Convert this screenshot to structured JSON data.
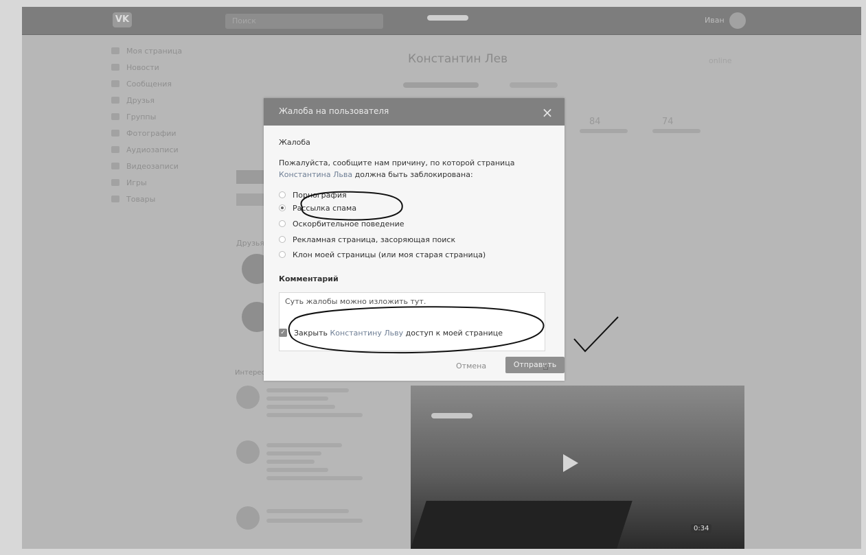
{
  "app": {
    "logo": "VK"
  },
  "header": {
    "search_placeholder": "Поиск",
    "user_name": "Иван"
  },
  "sidebar": {
    "items": [
      {
        "label": "Моя страница",
        "icon": "home-icon"
      },
      {
        "label": "Новости",
        "icon": "news-icon"
      },
      {
        "label": "Сообщения",
        "icon": "message-icon"
      },
      {
        "label": "Друзья",
        "icon": "friends-icon"
      },
      {
        "label": "Группы",
        "icon": "groups-icon"
      },
      {
        "label": "Фотографии",
        "icon": "photo-icon"
      },
      {
        "label": "Аудиозаписи",
        "icon": "music-icon"
      },
      {
        "label": "Видеозаписи",
        "icon": "video-icon"
      },
      {
        "label": "Игры",
        "icon": "games-icon"
      },
      {
        "label": "Товары",
        "icon": "goods-icon"
      }
    ]
  },
  "profile": {
    "name": "Константин Лев",
    "status": "online",
    "stats": [
      {
        "number": "84"
      },
      {
        "number": "74"
      }
    ]
  },
  "left_column": {
    "friends_title": "Друзья",
    "interesting_title": "Интересные страницы"
  },
  "video": {
    "duration": "0:34"
  },
  "modal": {
    "title": "Жалоба на пользователя",
    "close_icon": "close-icon",
    "section_label": "Жалоба",
    "prompt_before": "Пожалуйста, сообщите нам причину, по которой страница",
    "prompt_link": "Константина Льва",
    "prompt_after": "должна быть заблокирована:",
    "options": [
      {
        "label": "Порнография",
        "checked": false
      },
      {
        "label": "Рассылка спама",
        "checked": true
      },
      {
        "label": "Оскорбительное поведение",
        "checked": false
      },
      {
        "label": "Рекламная страница, засоряющая поиск",
        "checked": false
      },
      {
        "label": "Клон моей страницы (или моя старая страница)",
        "checked": false
      }
    ],
    "comment_label": "Комментарий",
    "comment_value": "Суть жалобы можно изложить тут.",
    "block_checkbox_before": "Закрыть",
    "block_checkbox_link": "Константину Льву",
    "block_checkbox_after": "доступ к моей странице",
    "block_checkbox_checked": true,
    "cancel_label": "Отмена",
    "send_label": "Отправить"
  },
  "colors": {
    "modal_header": "#808080",
    "overlay": "#b7b7b7",
    "link": "#6f7f95"
  }
}
